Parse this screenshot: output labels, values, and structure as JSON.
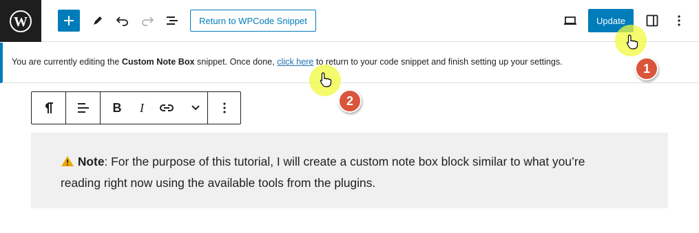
{
  "topbar": {
    "logo_icon": "wordpress-logo-icon",
    "add_icon": "plus-icon",
    "tools_icon": "pencil-icon",
    "undo_icon": "undo-icon",
    "redo_icon": "redo-icon",
    "outline_icon": "list-view-icon",
    "return_label": "Return to WPCode Snippet",
    "preview_icon": "laptop-icon",
    "update_label": "Update",
    "settings_icon": "sidebar-panel-icon",
    "options_icon": "vertical-ellipsis-icon",
    "accent_color": "#007cba"
  },
  "notice": {
    "prefix": "You are currently editing the",
    "snippet_name": "Custom Note Box",
    "middle": "snippet. Once done,",
    "link_text": "click here",
    "suffix": "to return to your code snippet and finish setting up your settings."
  },
  "block_toolbar": {
    "paragraph_icon": "pilcrow-icon",
    "align_icon": "align-left-icon",
    "bold_label": "B",
    "italic_label": "I",
    "link_icon": "link-icon",
    "more_icon": "chevron-down-icon",
    "options_icon": "vertical-ellipsis-icon"
  },
  "note": {
    "icon": "warning-icon",
    "bold_label": "Note",
    "line1": ": For the purpose of this tutorial, I will create a custom note box block similar to what you’re",
    "line2": "reading right now using the available tools from the plugins."
  },
  "annotations": {
    "badge1": "1",
    "badge2": "2",
    "badge_color": "#d9553b"
  }
}
